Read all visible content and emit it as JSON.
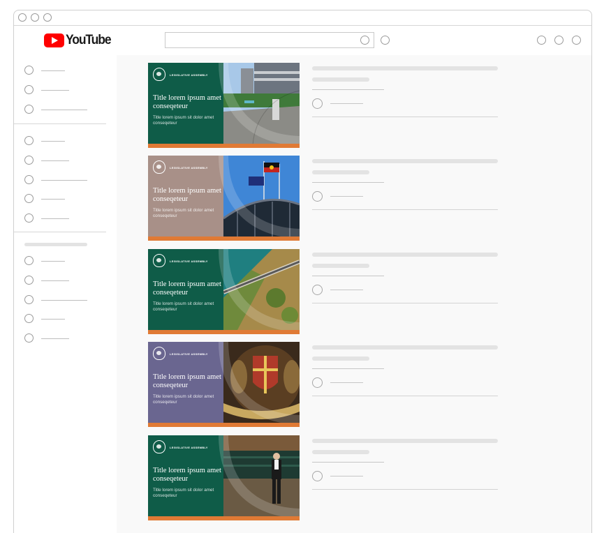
{
  "app": {
    "logo_text": "YouTube",
    "brand_color": "#ff0000"
  },
  "search": {
    "placeholder": "",
    "value": ""
  },
  "header_icons": [
    "apps-icon",
    "notifications-icon",
    "account-icon"
  ],
  "sidebar": {
    "sections": [
      {
        "items": [
          {
            "icon": "nav-icon"
          },
          {
            "icon": "nav-icon"
          },
          {
            "icon": "nav-icon"
          }
        ]
      },
      {
        "items": [
          {
            "icon": "nav-icon"
          },
          {
            "icon": "nav-icon"
          },
          {
            "icon": "nav-icon"
          },
          {
            "icon": "nav-icon"
          },
          {
            "icon": "nav-icon"
          }
        ]
      },
      {
        "items": [
          {
            "icon": "nav-icon"
          },
          {
            "icon": "nav-icon"
          },
          {
            "icon": "nav-icon"
          },
          {
            "icon": "nav-icon"
          },
          {
            "icon": "nav-icon"
          }
        ]
      }
    ]
  },
  "videos": [
    {
      "org": "LEGISLATIVE ASSEMBLY",
      "title": "Title lorem ipsum amet conseqeteur",
      "subtitle": "Title lorem ipsum sit dolor amet conseqeteur",
      "theme_color": "#0f5c48",
      "photo": "station-photo"
    },
    {
      "org": "LEGISLATIVE ASSEMBLY",
      "title": "Title lorem ipsum amet conseqeteur",
      "subtitle": "Title lorem ipsum sit dolor amet conseqeteur",
      "theme_color": "#a89088",
      "photo": "flags-bridge-photo"
    },
    {
      "org": "LEGISLATIVE ASSEMBLY",
      "title": "Title lorem ipsum amet conseqeteur",
      "subtitle": "Title lorem ipsum sit dolor amet conseqeteur",
      "theme_color": "#0f5c48",
      "photo": "coastal-road-photo"
    },
    {
      "org": "LEGISLATIVE ASSEMBLY",
      "title": "Title lorem ipsum amet conseqeteur",
      "subtitle": "Title lorem ipsum sit dolor amet conseqeteur",
      "theme_color": "#6a6690",
      "photo": "coat-of-arms-photo"
    },
    {
      "org": "LEGISLATIVE ASSEMBLY",
      "title": "Title lorem ipsum amet conseqeteur",
      "subtitle": "Title lorem ipsum sit dolor amet conseqeteur",
      "theme_color": "#0f5c48",
      "photo": "chamber-photo"
    }
  ]
}
